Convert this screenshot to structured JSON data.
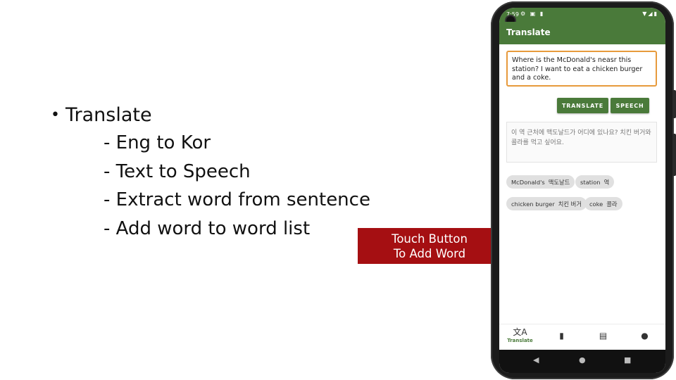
{
  "slide": {
    "bullet": "Translate",
    "sub_items": [
      "- Eng to Kor",
      "- Text to Speech",
      "- Extract word from sentence",
      "- Add word to word list"
    ]
  },
  "callout": {
    "line1": "Touch Button",
    "line2": "To Add Word"
  },
  "phone": {
    "status_bar": {
      "time": "7:59",
      "left_icons": "⚙ ▣ ▮",
      "right_icons": "▼◢▮"
    },
    "app_bar": {
      "title": "Translate"
    },
    "input": {
      "value": "Where is the McDonald's neasr this station? I want to eat a chicken burger and a coke."
    },
    "buttons": {
      "translate": "TRANSLATE",
      "speech": "SPEECH"
    },
    "output": {
      "value": "이 역 근처에 맥도날드가 어디에 있나요? 치킨 버거와 콜라를 먹고 싶어요."
    },
    "word_chips": [
      {
        "en": "McDonald's",
        "ko": "맥도날드"
      },
      {
        "en": "station",
        "ko": "역"
      },
      {
        "en": "chicken burger",
        "ko": "치킨 버거"
      },
      {
        "en": "coke",
        "ko": "콜라"
      }
    ],
    "bottom_nav": [
      {
        "icon": "translate-icon",
        "glyph": "文A",
        "label": "Translate"
      },
      {
        "icon": "book-icon",
        "glyph": "▮",
        "label": ""
      },
      {
        "icon": "chat-icon",
        "glyph": "▤",
        "label": ""
      },
      {
        "icon": "person-icon",
        "glyph": "●",
        "label": ""
      }
    ],
    "system_nav": {
      "back": "◀",
      "home": "●",
      "recents": "■"
    },
    "colors": {
      "primary": "#4a7a3a",
      "input_border": "#e79a3c",
      "callout": "#a50f12"
    }
  }
}
